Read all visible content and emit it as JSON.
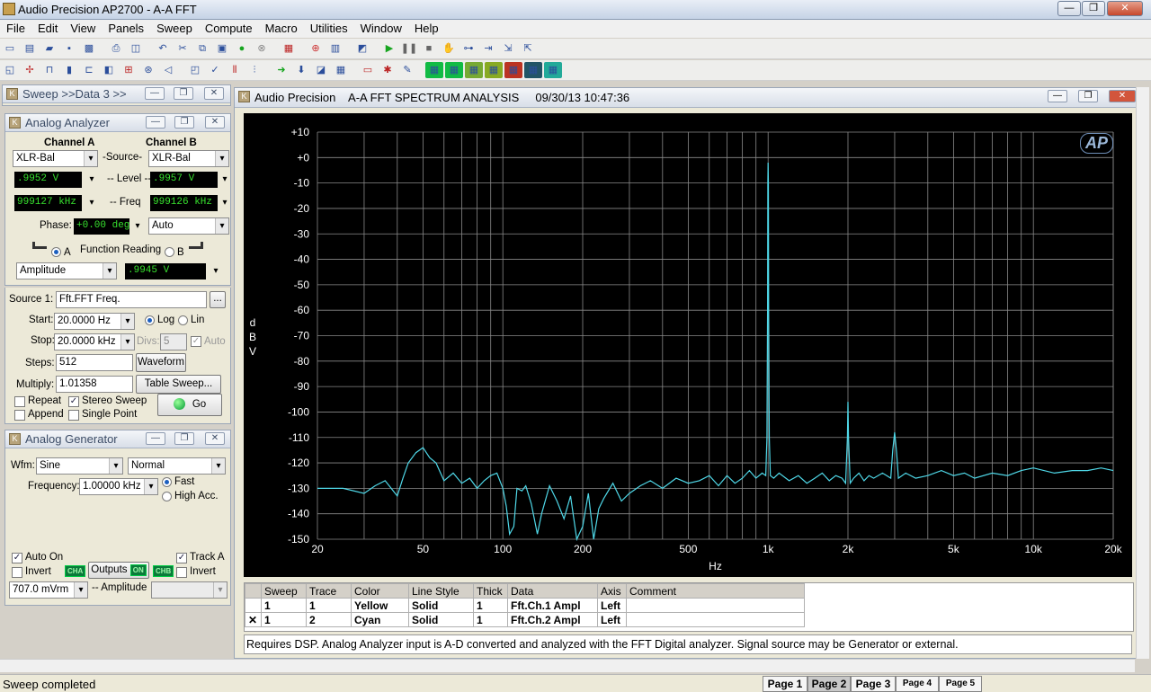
{
  "app": {
    "title": "Audio Precision AP2700 - A-A FFT",
    "min": "—",
    "max": "❐",
    "close": "✕"
  },
  "menu": [
    "File",
    "Edit",
    "View",
    "Panels",
    "Sweep",
    "Compute",
    "Macro",
    "Utilities",
    "Window",
    "Help"
  ],
  "sweep_panel": {
    "title": "Sweep >>Data 3 >>"
  },
  "analyzer": {
    "title": "Analog Analyzer",
    "channel_a": "Channel A",
    "channel_b": "Channel B",
    "source_label": "-Source-",
    "source_a": "XLR-Bal",
    "source_b": "XLR-Bal",
    "level_label": "-- Level --",
    "level_a": ".9952  V",
    "level_b": ".9957  V",
    "freq_label": "-- Freq",
    "freq_a": "999127 kHz",
    "freq_b": "999126 kHz",
    "phase_label": "Phase:",
    "phase_value": "+0.00  deg",
    "phase_mode": "Auto",
    "func_label": "Function Reading",
    "func_a": "A",
    "func_b": "B",
    "func_type": "Amplitude",
    "func_value": ".9945  V"
  },
  "sweep": {
    "source_label": "Source 1:",
    "source": "Fft.FFT Freq.",
    "browse": "...",
    "start_label": "Start:",
    "start": "20.0000  Hz",
    "stop_label": "Stop:",
    "stop": "20.0000 kHz",
    "log": "Log",
    "lin": "Lin",
    "divs_label": "Divs:",
    "divs": "5",
    "auto": "Auto",
    "steps_label": "Steps:",
    "steps": "512",
    "multiply_label": "Multiply:",
    "multiply": "1.01358",
    "waveform": "Waveform",
    "table_sweep": "Table Sweep...",
    "repeat": "Repeat",
    "append": "Append",
    "stereo": "Stereo Sweep",
    "single": "Single Point",
    "go": "Go"
  },
  "generator": {
    "title": "Analog Generator",
    "wfm_label": "Wfm:",
    "wfm": "Sine",
    "mode": "Normal",
    "freq_label": "Frequency:",
    "freq": "1.00000 kHz",
    "fast": "Fast",
    "high_acc": "High Acc.",
    "auto_on": "Auto On",
    "track_a": "Track A",
    "invert": "Invert",
    "outputs": "Outputs",
    "on": "ON",
    "cha": "CHA",
    "chb": "CHB",
    "amp": "707.0   mVrm",
    "amp_label": "-- Amplitude"
  },
  "graph": {
    "title": "Audio Precision    A-A FFT SPECTRUM ANALYSIS     09/30/13 10:47:36",
    "ap_logo": "AP"
  },
  "chart_data": {
    "type": "line",
    "xlabel": "Hz",
    "ylabel": "dBV",
    "xscale": "log",
    "xlim": [
      20,
      20000
    ],
    "ylim": [
      -150,
      10
    ],
    "xticks": [
      {
        "v": 20,
        "t": "20"
      },
      {
        "v": 50,
        "t": "50"
      },
      {
        "v": 100,
        "t": "100"
      },
      {
        "v": 200,
        "t": "200"
      },
      {
        "v": 500,
        "t": "500"
      },
      {
        "v": 1000,
        "t": "1k"
      },
      {
        "v": 2000,
        "t": "2k"
      },
      {
        "v": 5000,
        "t": "5k"
      },
      {
        "v": 10000,
        "t": "10k"
      },
      {
        "v": 20000,
        "t": "20k"
      }
    ],
    "yticks": [
      {
        "v": 10,
        "t": "+10"
      },
      {
        "v": 0,
        "t": "+0"
      },
      {
        "v": -10,
        "t": "-10"
      },
      {
        "v": -20,
        "t": "-20"
      },
      {
        "v": -30,
        "t": "-30"
      },
      {
        "v": -40,
        "t": "-40"
      },
      {
        "v": -50,
        "t": "-50"
      },
      {
        "v": -60,
        "t": "-60"
      },
      {
        "v": -70,
        "t": "-70"
      },
      {
        "v": -80,
        "t": "-80"
      },
      {
        "v": -90,
        "t": "-90"
      },
      {
        "v": -100,
        "t": "-100"
      },
      {
        "v": -110,
        "t": "-110"
      },
      {
        "v": -120,
        "t": "-120"
      },
      {
        "v": -130,
        "t": "-130"
      },
      {
        "v": -140,
        "t": "-140"
      },
      {
        "v": -150,
        "t": "-150"
      }
    ],
    "grid": true,
    "color": "#4fd8e8",
    "series": [
      {
        "x": [
          20,
          25,
          30,
          33,
          36,
          40,
          42,
          44,
          47,
          50,
          53,
          56,
          60,
          65,
          70,
          75,
          80,
          85,
          90,
          95,
          100,
          103,
          106,
          110,
          113,
          118,
          122,
          128,
          135,
          140,
          150,
          160,
          170,
          180,
          190,
          200,
          210,
          220,
          230,
          240,
          260,
          280,
          300,
          330,
          360,
          400,
          450,
          500,
          550,
          600,
          650,
          700,
          750,
          800,
          850,
          900,
          950,
          980,
          990,
          995,
          998,
          1000,
          1002,
          1005,
          1010,
          1020,
          1050,
          1100,
          1200,
          1300,
          1400,
          1500,
          1600,
          1700,
          1800,
          1900,
          1960,
          1990,
          2000,
          2010,
          2040,
          2100,
          2200,
          2300,
          2400,
          2500,
          2700,
          2800,
          2900,
          2950,
          3000,
          3050,
          3100,
          3300,
          3600,
          4000,
          4500,
          5000,
          5500,
          6000,
          7000,
          8000,
          9000,
          10000,
          12000,
          14000,
          16000,
          18000,
          20000
        ],
        "y": [
          -130,
          -130,
          -132,
          -129,
          -127,
          -133,
          -126,
          -120,
          -116,
          -114,
          -118,
          -120,
          -127,
          -124,
          -128,
          -126,
          -130,
          -127,
          -125,
          -124,
          -130,
          -137,
          -148,
          -145,
          -130,
          -131,
          -129,
          -136,
          -148,
          -140,
          -129,
          -135,
          -142,
          -133,
          -150,
          -145,
          -132,
          -150,
          -138,
          -134,
          -128,
          -135,
          -132,
          -129,
          -127,
          -130,
          -126,
          -128,
          -127,
          -125,
          -129,
          -125,
          -128,
          -126,
          -123,
          -126,
          -124,
          -125,
          -110,
          -60,
          -10,
          -2,
          -10,
          -60,
          -110,
          -125,
          -126,
          -124,
          -127,
          -125,
          -128,
          -126,
          -124,
          -127,
          -125,
          -126,
          -128,
          -110,
          -96,
          -110,
          -128,
          -126,
          -124,
          -127,
          -125,
          -126,
          -124,
          -125,
          -126,
          -115,
          -108,
          -116,
          -126,
          -124,
          -126,
          -125,
          -123,
          -125,
          -124,
          -126,
          -124,
          -125,
          -123,
          -122,
          -124,
          -123,
          -123,
          -122,
          -123
        ]
      }
    ]
  },
  "trace_table": {
    "headers": [
      "Sweep",
      "Trace",
      "Color",
      "Line Style",
      "Thick",
      "Data",
      "Axis",
      "Comment"
    ],
    "rows": [
      {
        "sweep": "1",
        "trace": "1",
        "color": "Yellow",
        "style": "Solid",
        "thick": "1",
        "data": "Fft.Ch.1 Ampl",
        "axis": "Left",
        "checked": ""
      },
      {
        "sweep": "1",
        "trace": "2",
        "color": "Cyan",
        "style": "Solid",
        "thick": "1",
        "data": "Fft.Ch.2 Ampl",
        "axis": "Left",
        "checked": "✕"
      }
    ]
  },
  "comment": "Requires DSP.  Analog Analyzer input is A-D converted and analyzed with the FFT Digital analyzer.  Signal source may be Generator or external.",
  "status": {
    "text": "Sweep completed",
    "pages": [
      "Page 1",
      "Page 2",
      "Page 3",
      "Page 4",
      "Page 5"
    ]
  }
}
